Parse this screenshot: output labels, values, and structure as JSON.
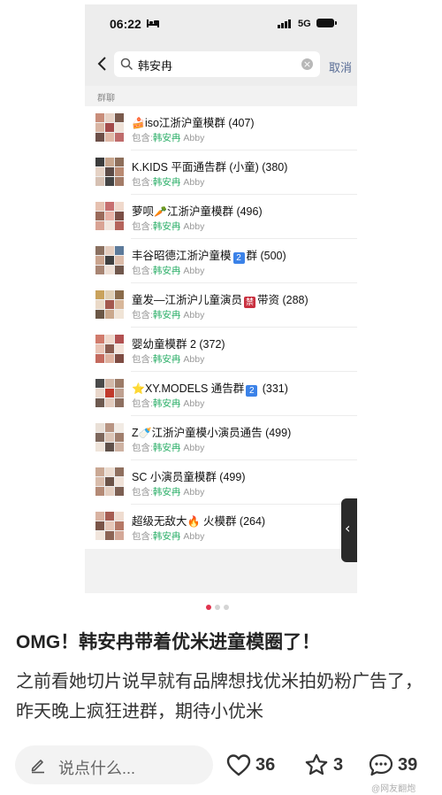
{
  "status_bar": {
    "time": "06:22",
    "network": "5G"
  },
  "search": {
    "query": "韩安冉",
    "cancel_label": "取消"
  },
  "section_label": "群聊",
  "groups": [
    {
      "emoji_before": "🍰",
      "title": "iso江浙沪童模群 (407)",
      "contains_label": "包含:",
      "match": "韩安冉",
      "nickname": "Abby"
    },
    {
      "title": "K.KIDS 平面通告群 (小童) (380)",
      "contains_label": "包含:",
      "match": "韩安冉",
      "nickname": "Abby"
    },
    {
      "title_prefix": "萝呗",
      "emoji": "🥕",
      "title_suffix": "江浙沪童模群 (496)",
      "contains_label": "包含:",
      "match": "韩安冉",
      "nickname": "Abby"
    },
    {
      "title_prefix": "丰谷昭德江浙沪童模",
      "badge": "2",
      "title_suffix": "群 (500)",
      "contains_label": "包含:",
      "match": "韩安冉",
      "nickname": "Abby"
    },
    {
      "title_prefix": "童发—江浙沪儿童演员",
      "badge": "禁",
      "title_suffix": "带资 (288)",
      "contains_label": "包含:",
      "match": "韩安冉",
      "nickname": "Abby"
    },
    {
      "title": "婴幼童模群 2 (372)",
      "contains_label": "包含:",
      "match": "韩安冉",
      "nickname": "Abby"
    },
    {
      "emoji_before": "⭐",
      "title_prefix": "XY.MODELS 通告群",
      "badge": "2",
      "title_suffix": " (331)",
      "contains_label": "包含:",
      "match": "韩安冉",
      "nickname": "Abby"
    },
    {
      "title_prefix": "Z",
      "emoji": "🍼",
      "title_suffix": "江浙沪童模小演员通告 (499)",
      "contains_label": "包含:",
      "match": "韩安冉",
      "nickname": "Abby"
    },
    {
      "title": "SC 小演员童模群 (499)",
      "contains_label": "包含:",
      "match": "韩安冉",
      "nickname": "Abby"
    },
    {
      "title_prefix": "超级无敌大",
      "emoji": "🔥",
      "title_suffix": " 火模群 (264)",
      "contains_label": "包含:",
      "match": "韩安冉",
      "nickname": "Abby"
    }
  ],
  "carousel": {
    "count": 3,
    "active": 1
  },
  "post": {
    "title": "OMG！韩安冉带着优米进童模圈了！",
    "body": "之前看她切片说早就有品牌想找优米拍奶粉广告了，昨天晚上疯狂进群，期待小优米"
  },
  "bottom_bar": {
    "comment_placeholder": "说点什么...",
    "likes": "36",
    "favorites": "3",
    "comments": "39"
  },
  "watermark": "@网友翻炮",
  "colors": {
    "link_blue": "#576b95",
    "match_green": "#2aae67",
    "badge_blue": "#3b82e8",
    "badge_red": "#c9303f",
    "active_dot": "#e0334e"
  }
}
